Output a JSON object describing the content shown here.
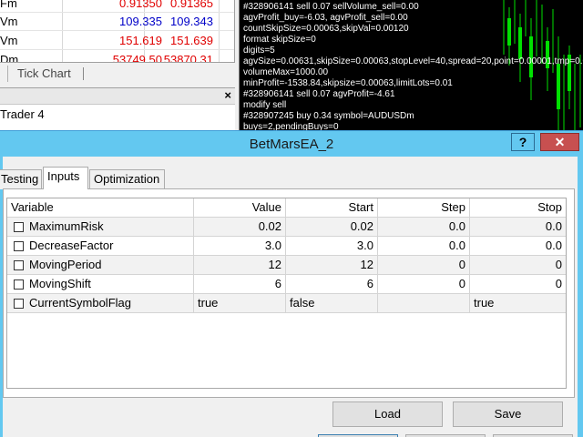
{
  "background": {
    "quotes": [
      {
        "symbol": "Fm",
        "bid": "0.91350",
        "ask": "0.91365",
        "color": "#e00000"
      },
      {
        "symbol": "Vm",
        "bid": "109.335",
        "ask": "109.343",
        "color": "#0000c8"
      },
      {
        "symbol": "Vm",
        "bid": "151.619",
        "ask": "151.639",
        "color": "#e00000"
      },
      {
        "symbol": "Dm",
        "bid": "53749.50",
        "ask": "53870.31",
        "color": "#e00000"
      }
    ],
    "tab_tick_chart": "Tick Chart",
    "nav_item": "Trader 4",
    "chart_lines": [
      "#328906141 sell 0.07 sellVolume_sell=0.00",
      "agvProfit_buy=-6.03, agvProfit_sell=0.00",
      "countSkipSize=0.00063,skipVal=0.00120",
      "format skipSize=0",
      "digits=5",
      "agvSize=0.00631,skipSize=0.00063,stopLevel=40,spread=20,point=0.00001,tmp=0.0000",
      "volumeMax=1000.00",
      "minProfit=-1538.84,skipsize=0.00063,limitLots=0.01",
      "#328906141 sell 0.07 agvProfit=-4.61",
      "modify sell",
      "#328907245 buy 0.34 symbol=AUDUSDm",
      "buys=2,pendingBuys=0"
    ],
    "chart_line_color": "#00e000"
  },
  "dialog": {
    "title": "BetMarsEA_2",
    "help_label": "?",
    "close_label": "✕",
    "tabs": [
      "Testing",
      "Inputs",
      "Optimization"
    ],
    "active_tab": "Inputs",
    "columns": [
      "Variable",
      "Value",
      "Start",
      "Step",
      "Stop"
    ],
    "rows": [
      {
        "variable": "MaximumRisk",
        "value": "0.02",
        "start": "0.02",
        "step": "0.0",
        "stop": "0.0",
        "checked": false
      },
      {
        "variable": "DecreaseFactor",
        "value": "3.0",
        "start": "3.0",
        "step": "0.0",
        "stop": "0.0",
        "checked": false
      },
      {
        "variable": "MovingPeriod",
        "value": "12",
        "start": "12",
        "step": "0",
        "stop": "0",
        "checked": false
      },
      {
        "variable": "MovingShift",
        "value": "6",
        "start": "6",
        "step": "0",
        "stop": "0",
        "checked": false
      },
      {
        "variable": "CurrentSymbolFlag",
        "value": "true",
        "start": "false",
        "step": "",
        "stop": "true",
        "checked": false
      }
    ],
    "load_label": "Load",
    "save_label": "Save",
    "titlebar_color": "#63c8f0",
    "close_color": "#c75050"
  }
}
